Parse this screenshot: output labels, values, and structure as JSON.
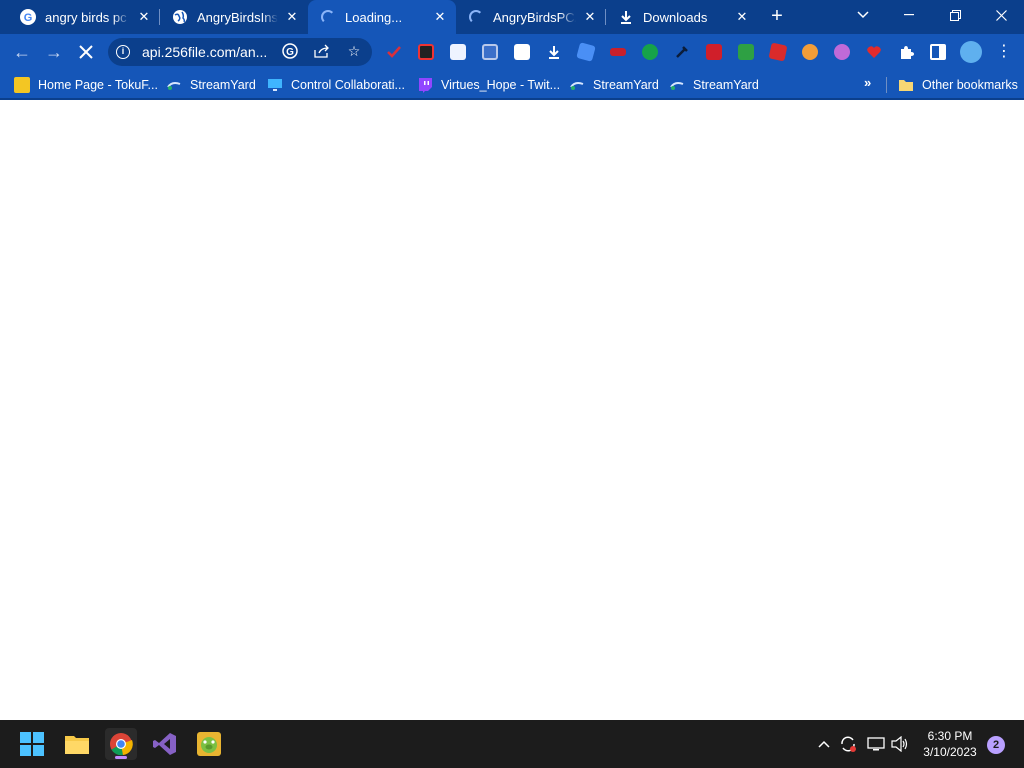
{
  "browser": {
    "tabs": [
      {
        "title": "angry birds pc c",
        "icon": "google-icon",
        "state": "normal"
      },
      {
        "title": "AngryBirdsInsta",
        "icon": "globe-icon",
        "state": "normal"
      },
      {
        "title": "Loading...",
        "icon": "loading-spinner-icon",
        "state": "active"
      },
      {
        "title": "AngryBirdsPCAll",
        "icon": "loading-spinner-icon",
        "state": "normal"
      },
      {
        "title": "Downloads",
        "icon": "download-icon",
        "state": "normal"
      }
    ],
    "address_bar": {
      "url": "api.256file.com/an..."
    },
    "bookmarks": [
      {
        "label": "Home Page - TokuF...",
        "icon": "tokufest-icon"
      },
      {
        "label": "StreamYard",
        "icon": "streamyard-icon"
      },
      {
        "label": "Control Collaborati...",
        "icon": "monitor-icon"
      },
      {
        "label": "Virtues_Hope - Twit...",
        "icon": "twitch-icon"
      },
      {
        "label": "StreamYard",
        "icon": "streamyard-icon"
      },
      {
        "label": "StreamYard",
        "icon": "streamyard-icon"
      }
    ],
    "other_bookmarks_label": "Other bookmarks",
    "colors": {
      "frame": "#0b3f8c",
      "toolbar": "#1556b8"
    }
  },
  "taskbar": {
    "apps": [
      {
        "name": "start-button",
        "icon": "windows-logo-icon"
      },
      {
        "name": "file-explorer",
        "icon": "folder-icon"
      },
      {
        "name": "chrome",
        "icon": "chrome-icon",
        "running": true
      },
      {
        "name": "visual-studio",
        "icon": "visual-studio-icon"
      },
      {
        "name": "angry-birds",
        "icon": "pig-icon"
      }
    ],
    "clock": {
      "time": "6:30 PM",
      "date": "3/10/2023"
    },
    "notification_count": "2"
  }
}
